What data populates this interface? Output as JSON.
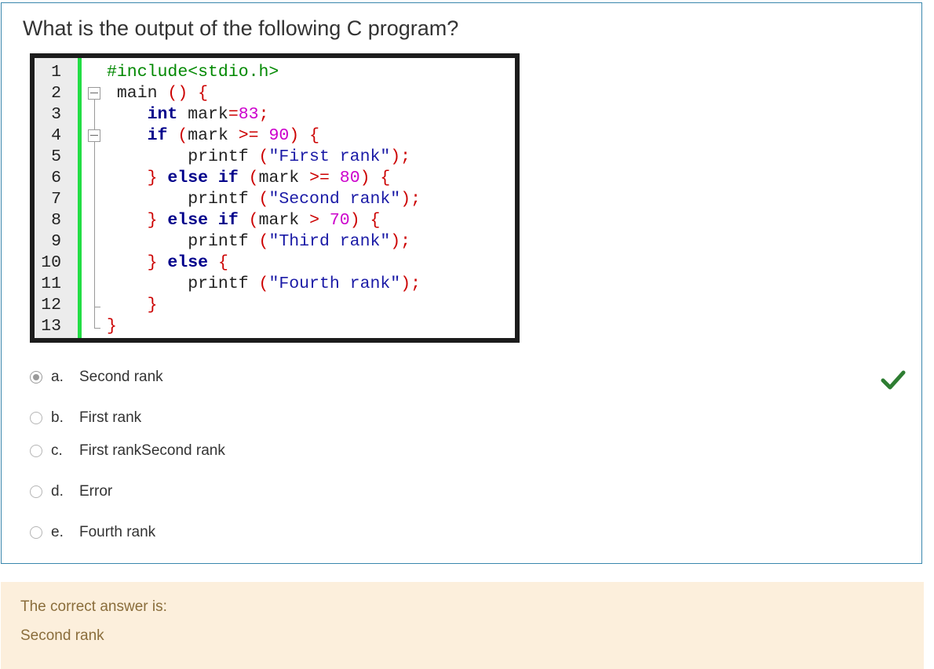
{
  "question": {
    "text": "What is the output of the following C program?",
    "code_line_numbers": [
      "1",
      "2",
      "3",
      "4",
      "5",
      "6",
      "7",
      "8",
      "9",
      "10",
      "11",
      "12",
      "13"
    ]
  },
  "options": [
    {
      "letter": "a.",
      "text": "Second rank",
      "selected": true
    },
    {
      "letter": "b.",
      "text": "First rank",
      "selected": false
    },
    {
      "letter": "c.",
      "text": "First rankSecond rank",
      "selected": false
    },
    {
      "letter": "d.",
      "text": "Error",
      "selected": false
    },
    {
      "letter": "e.",
      "text": "Fourth rank",
      "selected": false
    }
  ],
  "feedback": {
    "label": "The correct answer is:",
    "value": "Second rank"
  },
  "colors": {
    "border": "#3a87ad",
    "feedback_bg": "#fcefdc",
    "feedback_text": "#8a6d3b",
    "check": "#2e7d32",
    "gutter_accent": "#22dd44"
  },
  "icons": {
    "correct": "check-icon"
  }
}
